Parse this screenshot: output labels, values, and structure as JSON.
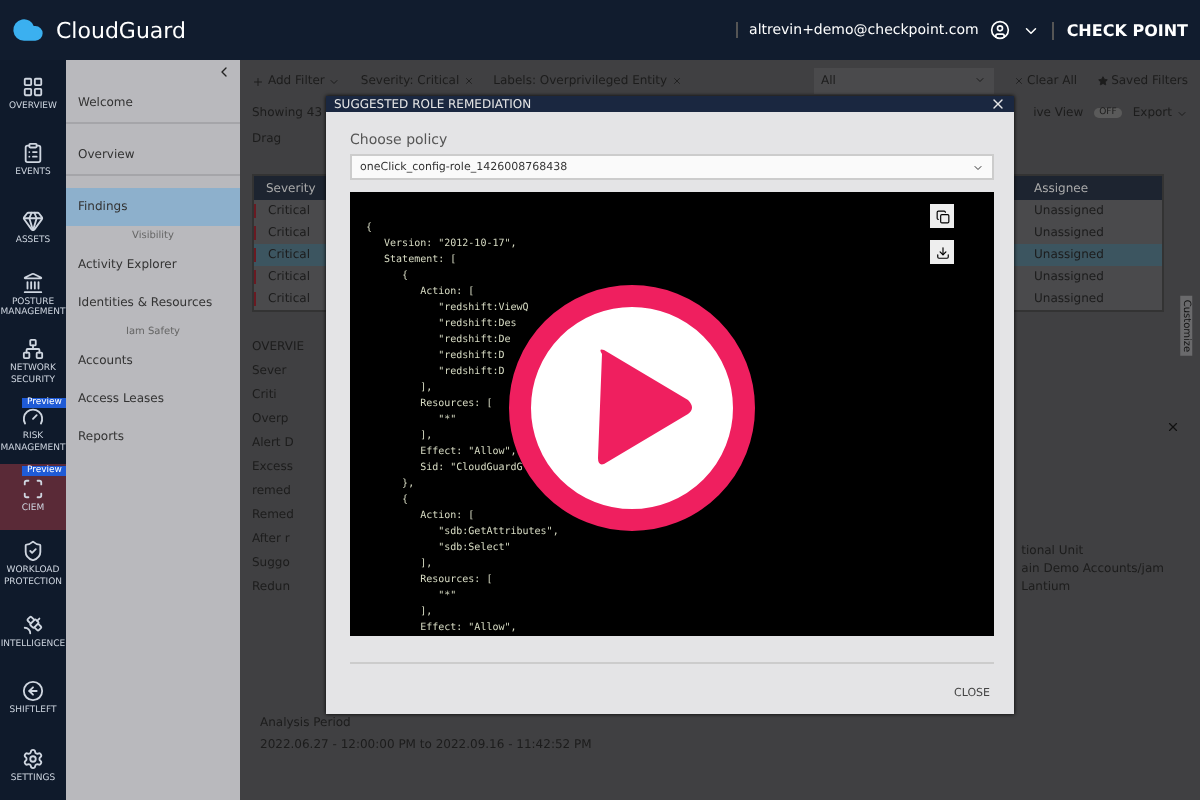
{
  "top_bar": {
    "product": "CloudGuard",
    "user": "altrevin+demo@checkpoint.com",
    "brand": "CHECK POINT"
  },
  "nav_rail": [
    {
      "label": "OVERVIEW",
      "selected": false
    },
    {
      "label": "EVENTS",
      "selected": false
    },
    {
      "label": "ASSETS",
      "selected": false
    },
    {
      "label": "POSTURE MANAGEMENT",
      "selected": false
    },
    {
      "label": "NETWORK SECURITY",
      "selected": false
    },
    {
      "label": "RISK MANAGEMENT",
      "selected": false,
      "badge": "Preview"
    },
    {
      "label": "CIEM",
      "selected": true,
      "badge": "Preview"
    },
    {
      "label": "WORKLOAD PROTECTION",
      "selected": false
    },
    {
      "label": "INTELLIGENCE",
      "selected": false
    },
    {
      "label": "SHIFTLEFT",
      "selected": false
    },
    {
      "label": "SETTINGS",
      "selected": false
    }
  ],
  "sub_nav": [
    {
      "kind": "item",
      "label": "Welcome",
      "selected": false
    },
    {
      "kind": "item",
      "label": "Overview",
      "selected": false
    },
    {
      "kind": "item",
      "label": "Findings",
      "selected": true
    },
    {
      "kind": "section",
      "label": "Visibility"
    },
    {
      "kind": "item",
      "label": "Activity Explorer",
      "selected": false
    },
    {
      "kind": "item",
      "label": "Identities & Resources",
      "selected": false
    },
    {
      "kind": "section",
      "label": "Iam Safety"
    },
    {
      "kind": "item",
      "label": "Accounts",
      "selected": false
    },
    {
      "kind": "item",
      "label": "Access Leases",
      "selected": false
    },
    {
      "kind": "item",
      "label": "Reports",
      "selected": false
    }
  ],
  "filters": {
    "add": "Add Filter",
    "chips": [
      "Severity: Critical",
      "Labels: Overprivileged Entity"
    ],
    "scope": "All",
    "clear": "Clear All",
    "saved": "Saved Filters"
  },
  "toolbar": {
    "count": "Showing 43",
    "group_hint": "Drag",
    "view": "ive View",
    "toggle": {
      "label": "OFF",
      "on": false
    },
    "export": "Export"
  },
  "table": {
    "columns": [
      "Severity",
      "Assignee"
    ],
    "rows": [
      {
        "severity": "Critical",
        "assignee": "Unassigned",
        "selected": false
      },
      {
        "severity": "Critical",
        "assignee": "Unassigned",
        "selected": false
      },
      {
        "severity": "Critical",
        "assignee": "Unassigned",
        "selected": true
      },
      {
        "severity": "Critical",
        "assignee": "Unassigned",
        "selected": false
      },
      {
        "severity": "Critical",
        "assignee": "Unassigned",
        "selected": false
      }
    ]
  },
  "side_tab": "Customize",
  "details": {
    "fragments": [
      "OVERVIE",
      "Sever",
      "Criti",
      "Overp",
      "Alert D",
      "Excess",
      "remed",
      "Remed",
      "After r",
      "Suggo",
      "Redun"
    ],
    "right": [
      "tional Unit",
      "ain Demo Accounts/jam",
      "Lantium"
    ],
    "period_label": "Analysis Period",
    "period": "2022.06.27 - 12:00:00 PM to 2022.09.16 - 11:42:52 PM"
  },
  "modal": {
    "title": "SUGGESTED ROLE REMEDIATION",
    "field_label": "Choose policy",
    "policy": "oneClick_config-role_1426008768438",
    "close": "CLOSE",
    "code": [
      "{",
      "   Version: \"2012-10-17\",",
      "   Statement: [",
      "      {",
      "         Action: [",
      "            \"redshift:ViewQ",
      "            \"redshift:Des",
      "            \"redshift:De",
      "            \"redshift:D",
      "            \"redshift:D",
      "         ],",
      "         Resources: [",
      "            \"*\"",
      "         ],",
      "         Effect: \"Allow\",",
      "         Sid: \"CloudGuardG",
      "      },",
      "      {",
      "         Action: [",
      "            \"sdb:GetAttributes\",",
      "            \"sdb:Select\"",
      "         ],",
      "         Resources: [",
      "            \"*\"",
      "         ],",
      "         Effect: \"Allow\","
    ]
  }
}
